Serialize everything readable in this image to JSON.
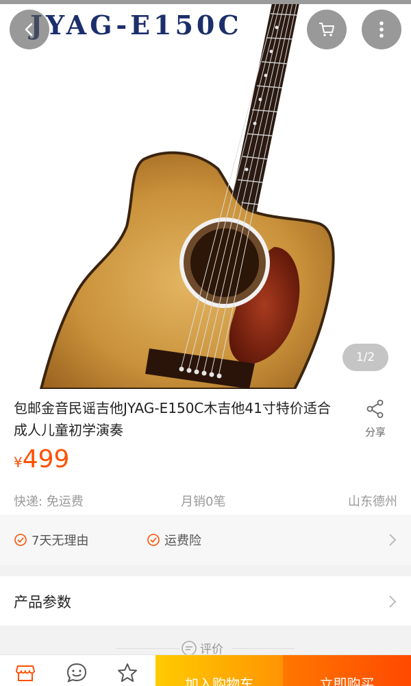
{
  "hero": {
    "brand_text": "JYAG-E150C",
    "page_indicator": "1/2"
  },
  "buttons": {
    "back_icon": "chevron-left-icon",
    "cart_icon": "cart-icon",
    "more_icon": "more-vertical-icon"
  },
  "product": {
    "title": "包邮金音民谣吉他JYAG-E150C木吉他41寸特价适合成人儿童初学演奏",
    "share_label": "分享",
    "price_symbol": "¥",
    "price": "499",
    "shipping": "快递: 免运费",
    "monthly_sales": "月销0笔",
    "location": "山东德州"
  },
  "services": {
    "items": [
      "7天无理由",
      "运费险"
    ]
  },
  "params": {
    "label": "产品参数"
  },
  "reviews": {
    "label": "评价"
  },
  "bottom_bar": {
    "add_to_cart": "加入购物车",
    "buy_now": "立即购买"
  },
  "colors": {
    "accent": "#ff5000",
    "add_cart_start": "#ffcb00",
    "add_cart_end": "#ff9402",
    "buy_now_start": "#ff7700",
    "buy_now_end": "#ff4900",
    "brand_blue": "#1c2f6b"
  }
}
